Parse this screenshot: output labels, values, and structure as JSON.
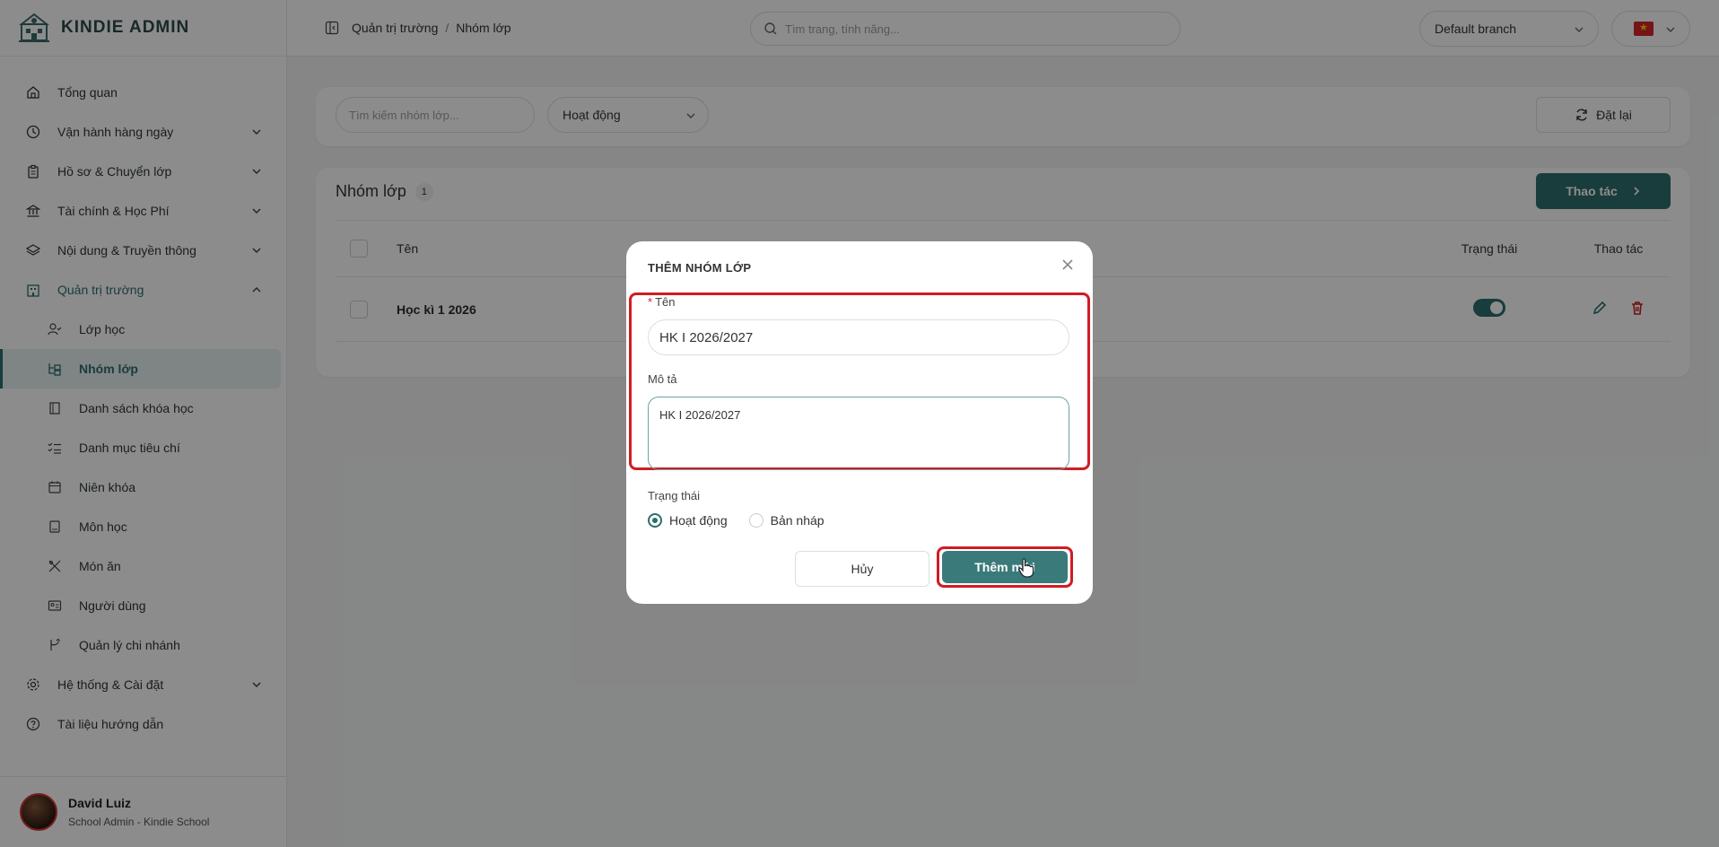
{
  "brand": {
    "name": "KINDIE ADMIN"
  },
  "sidebar": {
    "items": [
      {
        "label": "Tổng quan",
        "icon": "home-icon"
      },
      {
        "label": "Vận hành hàng ngày",
        "icon": "clock-icon"
      },
      {
        "label": "Hồ sơ & Chuyển lớp",
        "icon": "clipboard-icon"
      },
      {
        "label": "Tài chính & Học Phí",
        "icon": "bank-icon"
      },
      {
        "label": "Nội dung & Truyền thông",
        "icon": "layers-icon"
      },
      {
        "label": "Quản trị trường",
        "icon": "building-icon"
      }
    ],
    "sub_items": [
      {
        "label": "Lớp học",
        "icon": "user-check-icon"
      },
      {
        "label": "Nhóm lớp",
        "icon": "group-tree-icon"
      },
      {
        "label": "Danh sách khóa học",
        "icon": "book-icon"
      },
      {
        "label": "Danh mục tiêu chí",
        "icon": "checklist-icon"
      },
      {
        "label": "Niên khóa",
        "icon": "calendar-icon"
      },
      {
        "label": "Môn học",
        "icon": "notebook-icon"
      },
      {
        "label": "Món ăn",
        "icon": "utensils-icon"
      },
      {
        "label": "Người dùng",
        "icon": "id-card-icon"
      },
      {
        "label": "Quản lý chi nhánh",
        "icon": "branch-icon"
      }
    ],
    "bottom_items": [
      {
        "label": "Hệ thống & Cài đặt",
        "icon": "gear-icon"
      },
      {
        "label": "Tài liệu hướng dẫn",
        "icon": "help-icon"
      }
    ],
    "user": {
      "name": "David Luiz",
      "role": "School Admin - Kindie School"
    }
  },
  "topbar": {
    "breadcrumb": [
      "Quản trị trường",
      "Nhóm lớp"
    ],
    "breadcrumb_sep": "/",
    "search_placeholder": "Tìm trang, tính năng...",
    "branch": "Default branch"
  },
  "filters": {
    "search_placeholder": "Tìm kiếm nhóm lớp...",
    "status_select": "Hoạt động",
    "reset_label": "Đặt lại"
  },
  "list": {
    "title": "Nhóm lớp",
    "count": "1",
    "actions_label": "Thao tác",
    "columns": {
      "name": "Tên",
      "status": "Trạng thái",
      "actions": "Thao tác"
    },
    "rows": [
      {
        "name": "Học kì 1 2026",
        "active": true
      }
    ]
  },
  "modal": {
    "title": "THÊM NHÓM LỚP",
    "name_label": "Tên",
    "name_required": "*",
    "name_value": "HK I 2026/2027",
    "desc_label": "Mô tả",
    "desc_value": "HK I 2026/2027",
    "status_label": "Trạng thái",
    "status_options": [
      "Hoạt động",
      "Bản nháp"
    ],
    "status_selected": "Hoạt động",
    "cancel_label": "Hủy",
    "submit_label": "Thêm mới"
  },
  "colors": {
    "accent": "#2f6d6d",
    "highlight": "#d01c24"
  }
}
